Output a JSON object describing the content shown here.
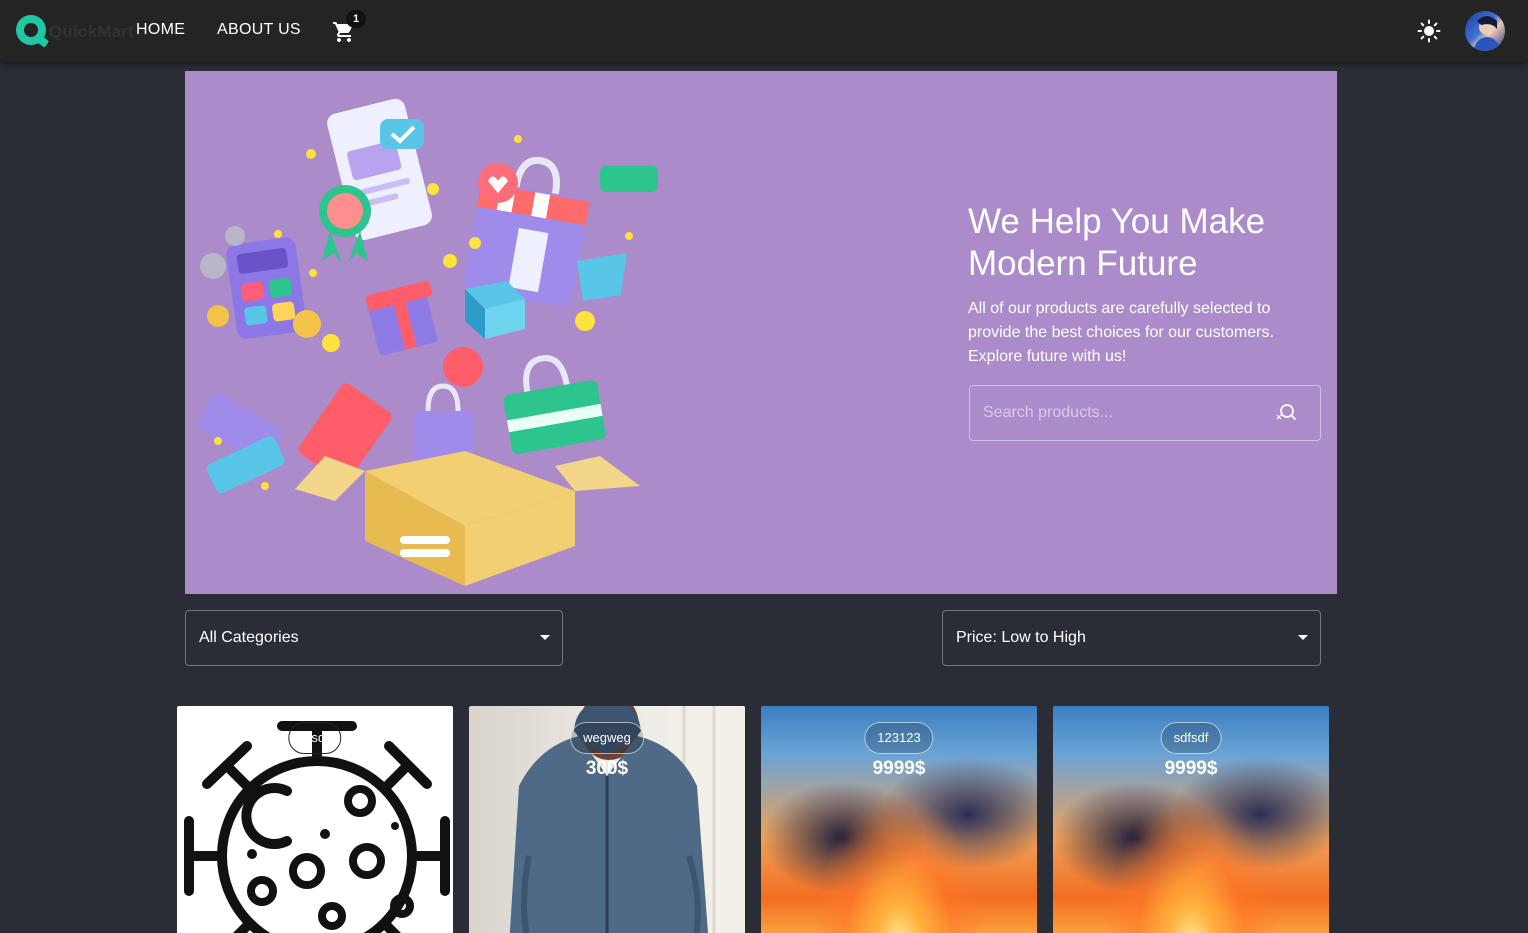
{
  "nav": {
    "brand": "QuickMart",
    "home": "HOME",
    "about": "ABOUT US",
    "cart_count": "1",
    "icons": [
      "cart-icon",
      "sun-icon",
      "avatar"
    ]
  },
  "hero": {
    "title": "We Help You Make Modern Future",
    "subtitle": "All of our products are carefully selected to provide the best choices for our customers. Explore future with us!",
    "search_placeholder": "Search products..."
  },
  "filters": {
    "category": "All Categories",
    "sort": "Price: Low to High"
  },
  "products": [
    {
      "name": "sfsdf",
      "price": ""
    },
    {
      "name": "wegweg",
      "price": "300$"
    },
    {
      "name": "123123",
      "price": "9999$"
    },
    {
      "name": "sdfsdf",
      "price": "9999$"
    }
  ],
  "colors": {
    "background": "#2b2d36",
    "navbar": "#242424",
    "hero": "#ab8bc9",
    "brand_accent": "#1fc7a3"
  }
}
